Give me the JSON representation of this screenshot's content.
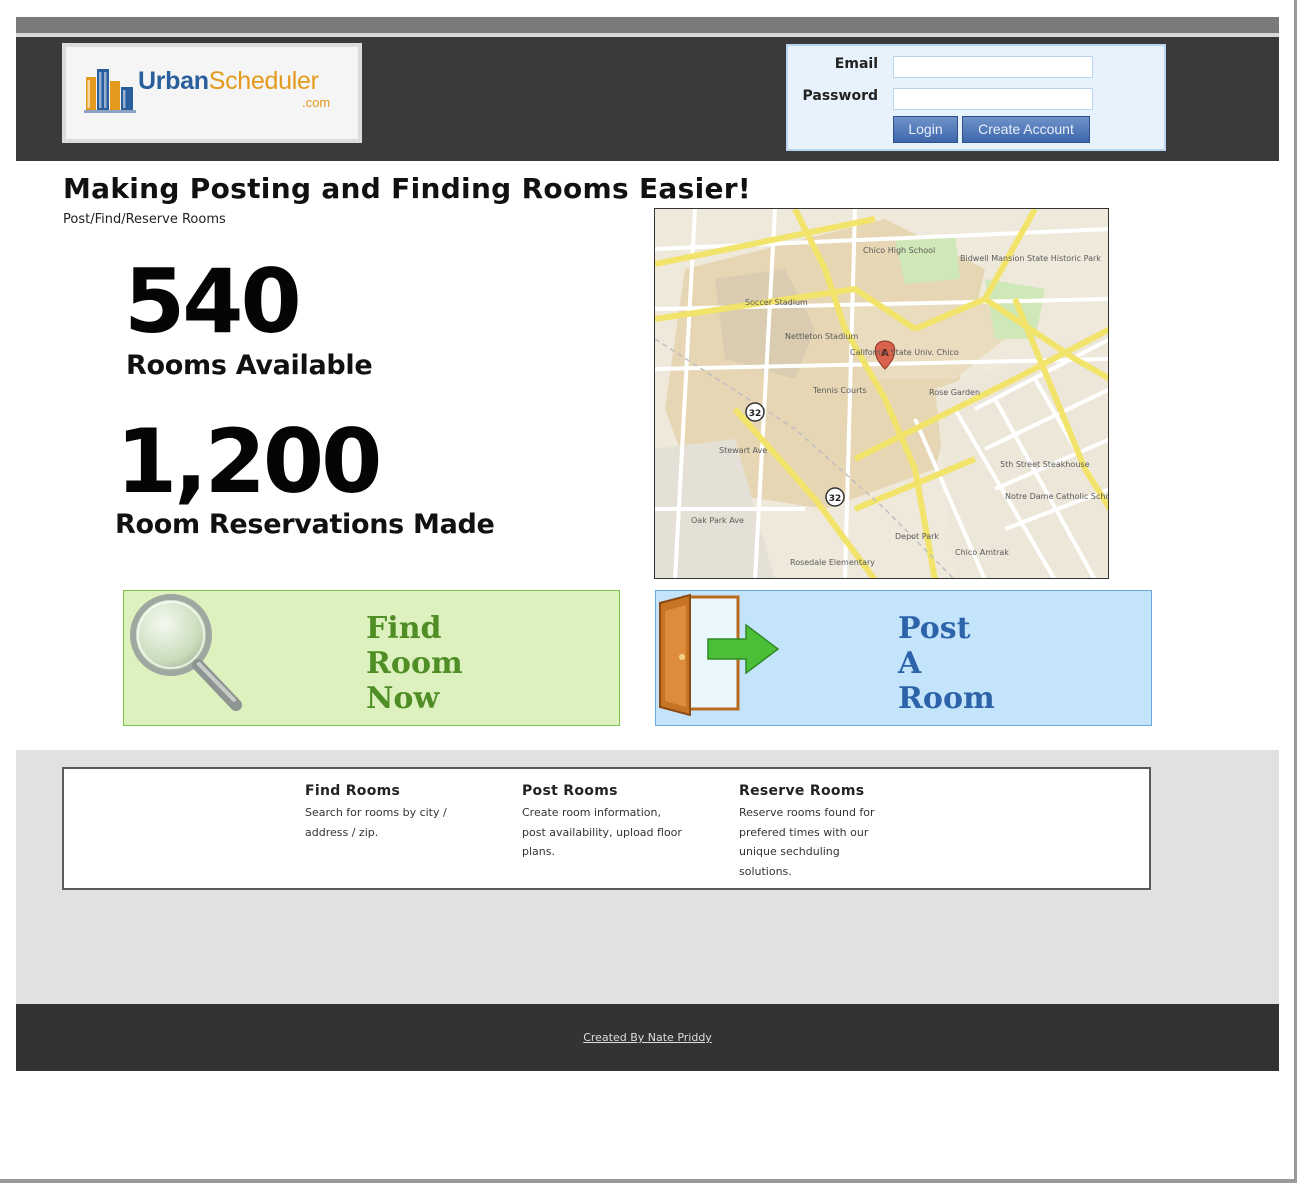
{
  "brand": {
    "name_part1": "Urban",
    "name_part2": "Scheduler",
    "suffix": ".com",
    "colors": {
      "primary": "#2a5f9e",
      "secondary": "#e49a1c"
    }
  },
  "login": {
    "email_label": "Email",
    "password_label": "Password",
    "email_value": "",
    "password_value": "",
    "login_button": "Login",
    "create_account_button": "Create Account"
  },
  "hero": {
    "headline": "Making Posting and Finding Rooms Easier!",
    "subline": "Post/Find/Reserve Rooms"
  },
  "stats": [
    {
      "value": "540",
      "label": "Rooms Available"
    },
    {
      "value": "1,200",
      "label": "Room Reservations Made"
    }
  ],
  "map": {
    "labels": {
      "chico_high": "Chico High School",
      "bidwell": "Bidwell Mansion State Historic Park",
      "soccer": "Soccer Stadium",
      "nettleton": "Nettleton Stadium",
      "csu": "California State Univ. Chico",
      "rose": "Rose Garden",
      "tennis": "Tennis Courts",
      "stewart": "Stewart Ave",
      "oak_park": "Oak Park Ave",
      "rosedale": "Rosedale Elementary",
      "depot": "Depot Park",
      "amtrak": "Chico Amtrak",
      "steakhouse": "5th Street Steakhouse",
      "notre_dame": "Notre Dame Catholic School",
      "route": "32",
      "marker": "A"
    }
  },
  "cta": {
    "find": {
      "line1": "Find",
      "line2": "Room",
      "line3": "Now",
      "color": "#4f8e25"
    },
    "post": {
      "line1": "Post",
      "line2": "A",
      "line3": "Room",
      "color": "#2d63a8"
    }
  },
  "features": [
    {
      "title": "Find Rooms",
      "text": "Search for rooms by city / address / zip."
    },
    {
      "title": "Post Rooms",
      "text": "Create room information, post availability, upload floor plans."
    },
    {
      "title": "Reserve Rooms",
      "text": "Reserve rooms found for prefered times with our unique sechduling solutions."
    }
  ],
  "footer": {
    "credit": "Created By Nate Priddy"
  }
}
